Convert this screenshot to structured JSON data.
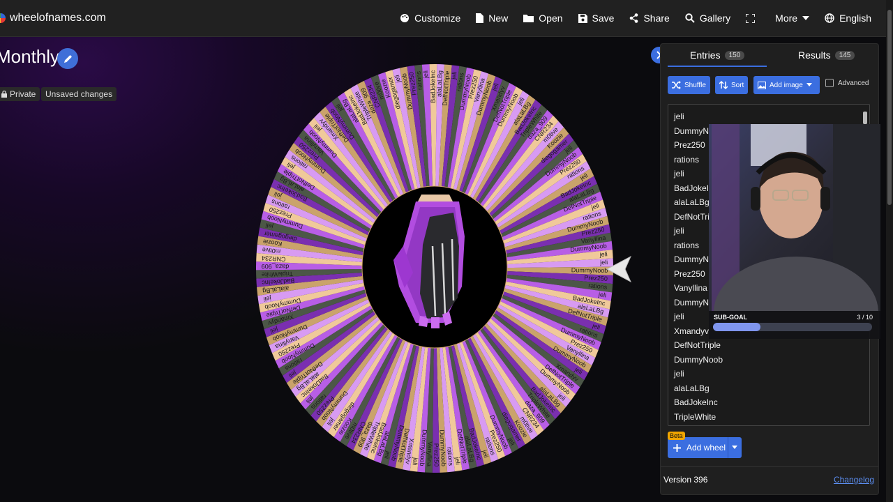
{
  "app": {
    "brand": "wheelofnames.com"
  },
  "nav": [
    {
      "label": "Customize",
      "icon": "palette-icon"
    },
    {
      "label": "New",
      "icon": "new-file-icon"
    },
    {
      "label": "Open",
      "icon": "folder-icon"
    },
    {
      "label": "Save",
      "icon": "save-icon"
    },
    {
      "label": "Share",
      "icon": "share-icon"
    },
    {
      "label": "Gallery",
      "icon": "search-icon"
    },
    {
      "label": "",
      "icon": "fullscreen-icon"
    },
    {
      "label": "More",
      "icon": "caret-down-icon"
    },
    {
      "label": "English",
      "icon": "globe-icon"
    }
  ],
  "wheel": {
    "title": "Monthly",
    "visibility": "Private",
    "status": "Unsaved changes",
    "labels": [
      "jeli",
      "DummyNoob",
      "Prez250",
      "rations",
      "jeli",
      "BadJokeInc",
      "alaLaLBg",
      "DefNotTriple",
      "jeli",
      "rations",
      "DummyNoob",
      "Prez250",
      "Vanyllina",
      "DummyNoob",
      "jeli",
      "Xmandyv",
      "DefNotTriple",
      "DummyNoob",
      "jeli",
      "alaLaLBg",
      "BadJokeInc",
      "TripleWhite",
      "daza_909",
      "CNR234",
      "m0tive",
      "Koozie",
      "diegogamer"
    ],
    "colors": [
      "#d89bf2",
      "#caa36b",
      "#7a2fb0",
      "#4c5747",
      "#b85ee6",
      "#f0c99a"
    ]
  },
  "panel": {
    "tabs": [
      {
        "label": "Entries",
        "count": "150"
      },
      {
        "label": "Results",
        "count": "145"
      }
    ],
    "toolbar": {
      "shuffle": "Shuffle",
      "sort": "Sort",
      "add_image": "Add image",
      "advanced": "Advanced"
    },
    "entries": [
      "jeli",
      "DummyN",
      "Prez250",
      "rations",
      "jeli",
      "BadJokeI",
      "alaLaLBg",
      "DefNotTri",
      "jeli",
      "rations",
      "DummyN",
      "Prez250",
      "Vanyllina",
      "DummyN",
      "jeli",
      "Xmandyv",
      "DefNotTriple",
      "DummyNoob",
      "jeli",
      "alaLaLBg",
      "BadJokeInc",
      "TripleWhite"
    ],
    "beta": "Beta",
    "add_wheel": "Add wheel",
    "version": "Version 396",
    "changelog": "Changelog"
  },
  "overlay": {
    "subgoal_label": "SUB-GOAL",
    "subgoal_count": "3 / 10",
    "subgoal_progress": 0.3
  }
}
